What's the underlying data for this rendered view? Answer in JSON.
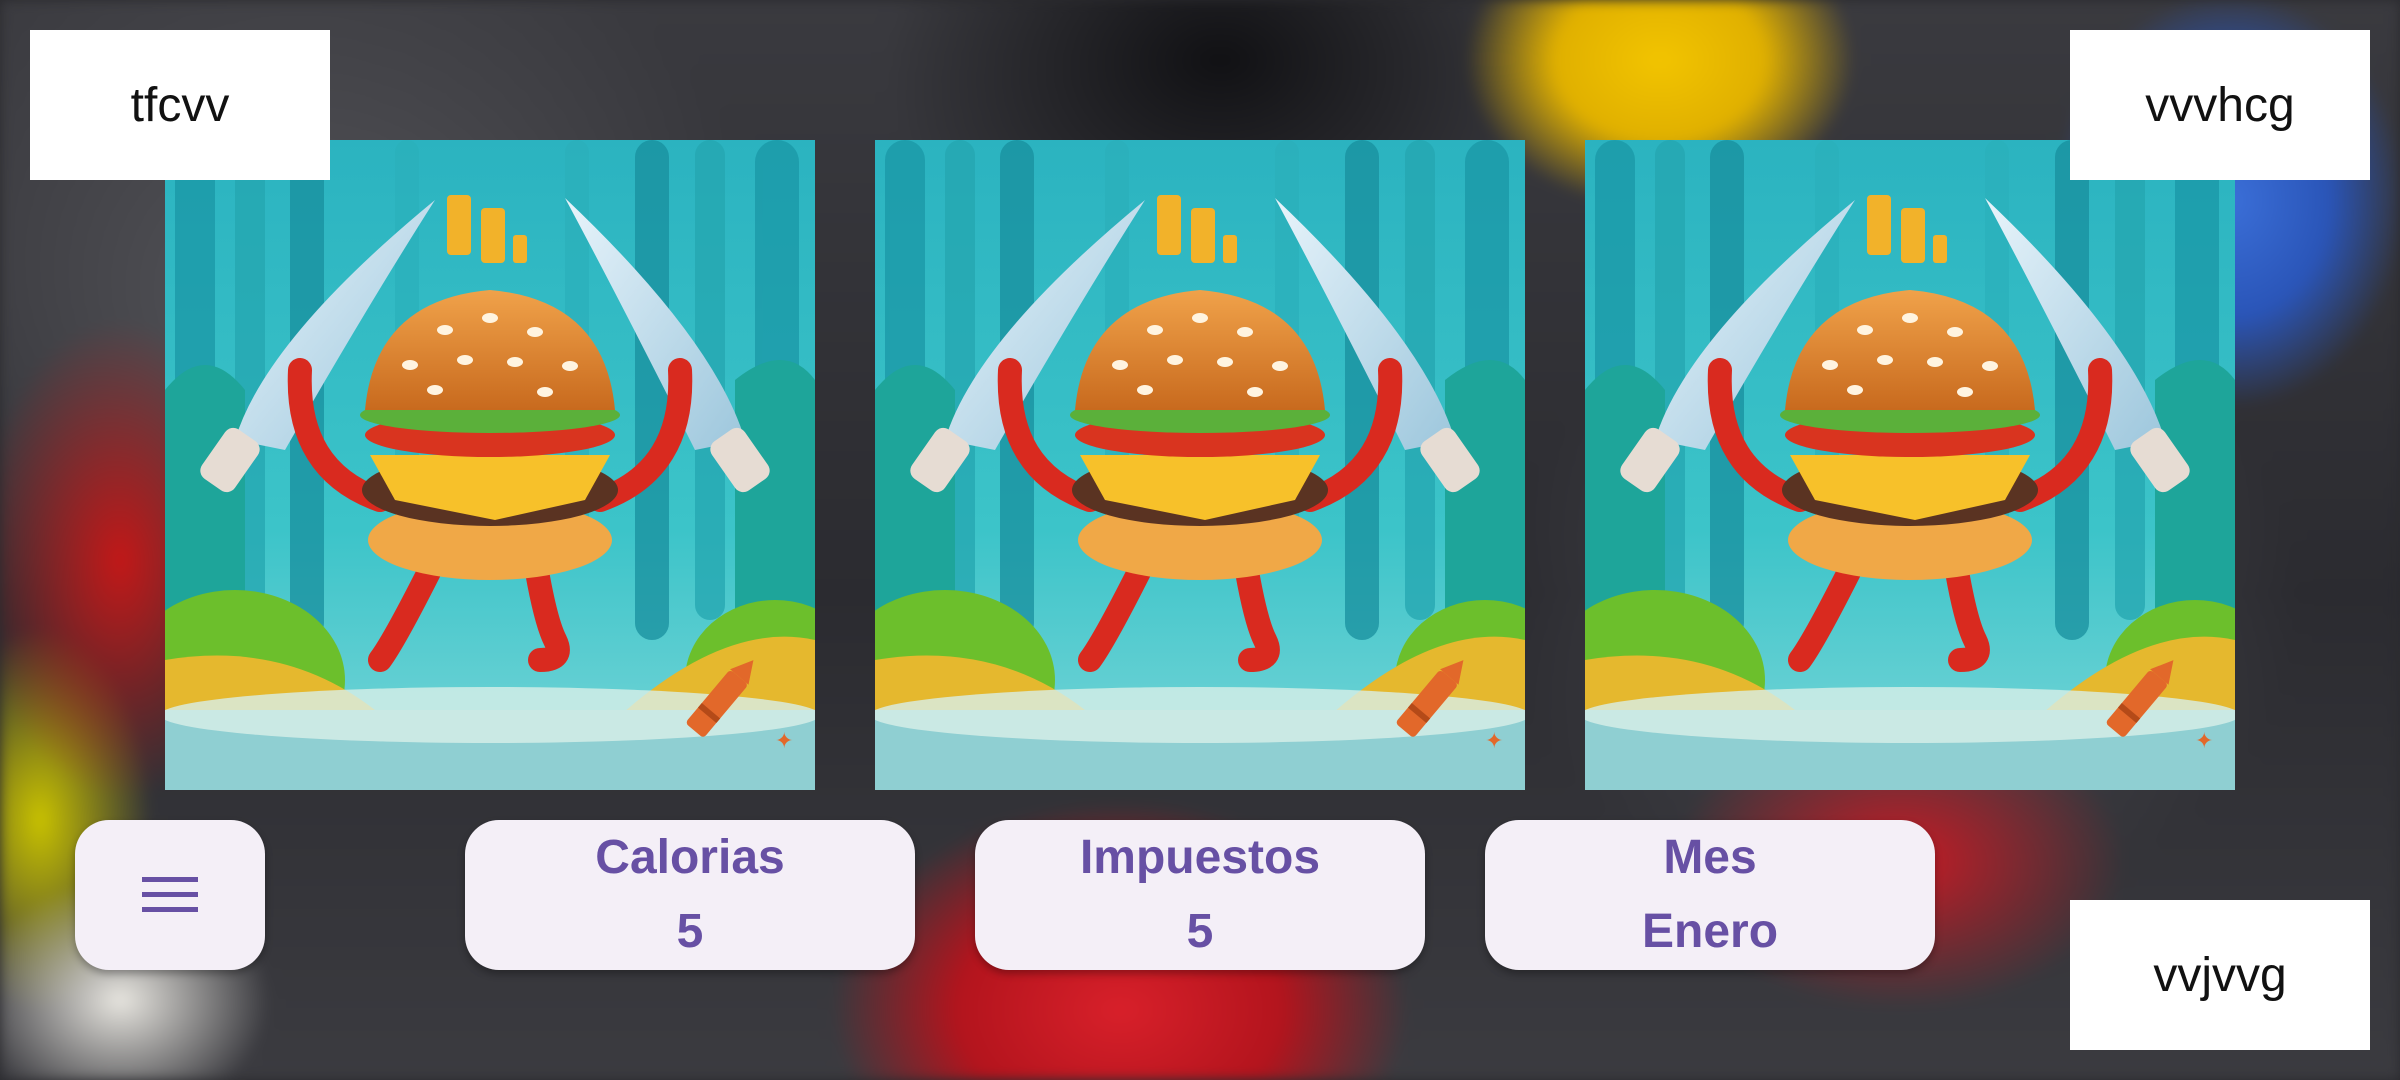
{
  "corner_labels": {
    "top_left": "tfcvv",
    "top_right": "vvvhcg",
    "bottom_right": "vvjvvg"
  },
  "cards": [
    {
      "icon": "burger-character-image"
    },
    {
      "icon": "burger-character-image"
    },
    {
      "icon": "burger-character-image"
    }
  ],
  "menu": {
    "icon": "hamburger-menu-icon"
  },
  "stats": [
    {
      "label": "Calorias",
      "value": "5"
    },
    {
      "label": "Impuestos",
      "value": "5"
    },
    {
      "label": "Mes",
      "value": "Enero"
    }
  ],
  "colors": {
    "accent": "#6750a4",
    "pill_background": "#f4eff7",
    "label_background": "#ffffff"
  }
}
